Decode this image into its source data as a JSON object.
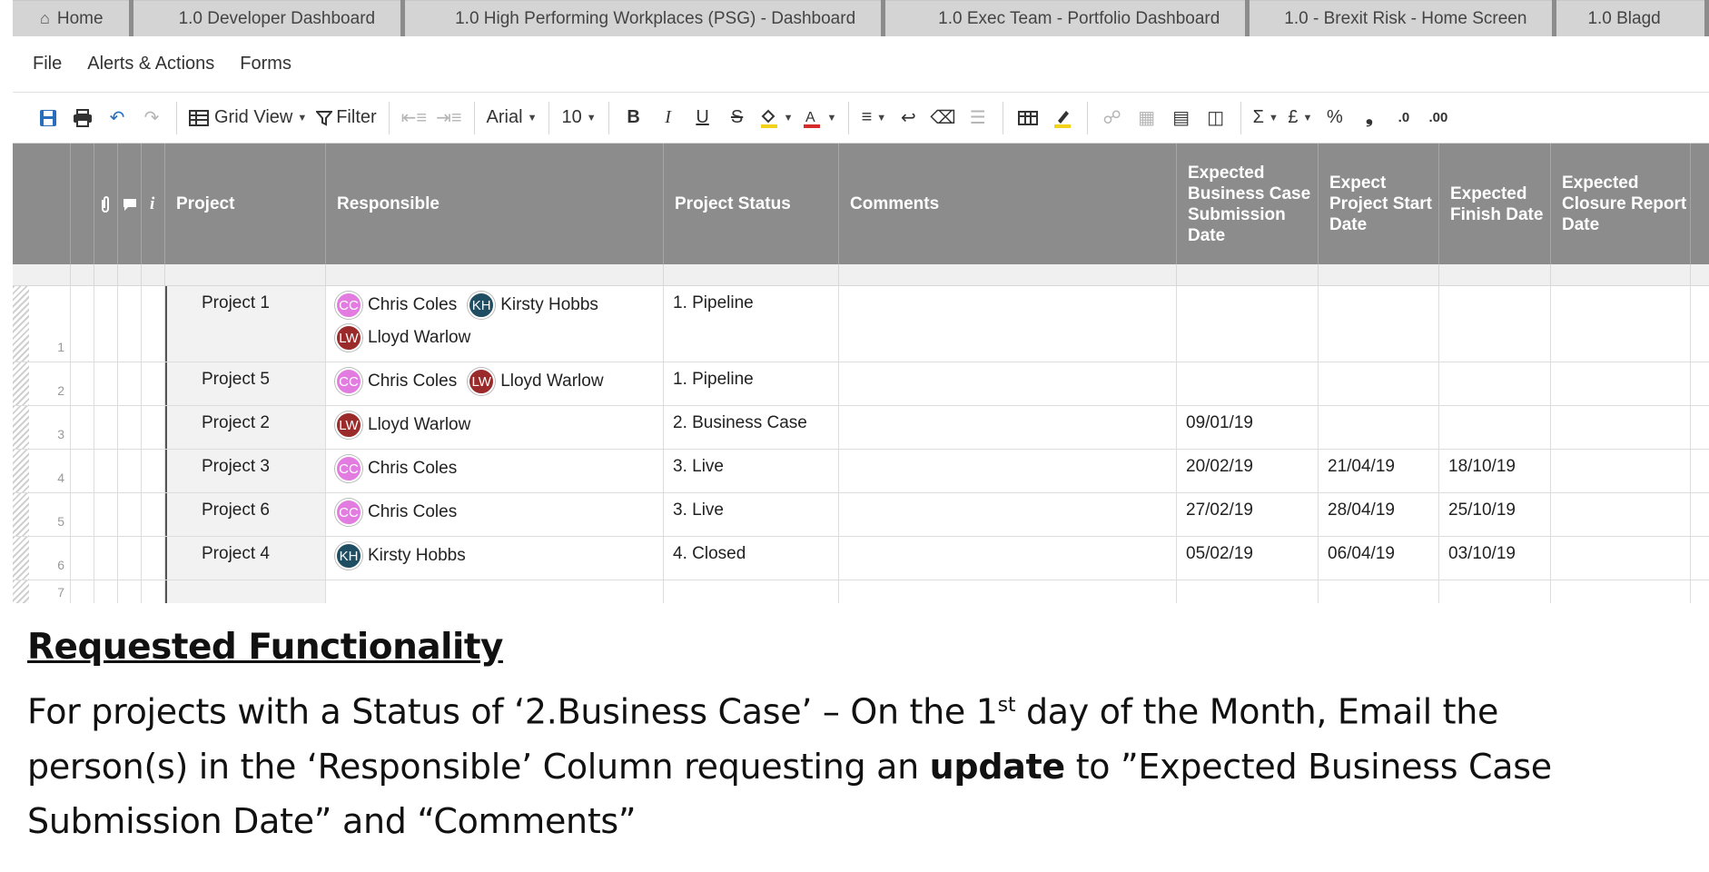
{
  "tabs": [
    {
      "label": "Home",
      "icon": "home-icon"
    },
    {
      "label": "1.0 Developer Dashboard"
    },
    {
      "label": "1.0 High Performing Workplaces (PSG) - Dashboard"
    },
    {
      "label": "1.0 Exec Team - Portfolio Dashboard"
    },
    {
      "label": "1.0 - Brexit Risk - Home Screen"
    },
    {
      "label": "1.0 Blagd"
    }
  ],
  "menu": {
    "file": "File",
    "alerts": "Alerts & Actions",
    "forms": "Forms"
  },
  "toolbar": {
    "grid_view": "Grid View",
    "filter": "Filter",
    "font": "Arial",
    "font_size": "10",
    "bold": "B",
    "italic": "I",
    "underline": "U",
    "strike": "S",
    "sum": "Σ",
    "currency": "£",
    "percent": "%",
    "comma": "❟",
    "dec_less": ".0",
    "dec_more": ".00"
  },
  "columns": {
    "project": "Project",
    "responsible": "Responsible",
    "status": "Project Status",
    "comments": "Comments",
    "business_case": "Expected Business Case Submission Date",
    "start": "Expect Project Start Date",
    "finish": "Expected Finish Date",
    "closure": "Expected Closure Report Date",
    "info": "i"
  },
  "rows": [
    {
      "num": "1",
      "project": "Project 1",
      "people": [
        {
          "initials": "CC",
          "name": "Chris Coles"
        },
        {
          "initials": "KH",
          "name": "Kirsty Hobbs"
        },
        {
          "initials": "LW",
          "name": "Lloyd Warlow"
        }
      ],
      "status": "1. Pipeline",
      "comments": "",
      "business_case": "",
      "start": "",
      "finish": "",
      "closure": ""
    },
    {
      "num": "2",
      "project": "Project 5",
      "people": [
        {
          "initials": "CC",
          "name": "Chris Coles"
        },
        {
          "initials": "LW",
          "name": "Lloyd Warlow"
        }
      ],
      "status": "1. Pipeline",
      "comments": "",
      "business_case": "",
      "start": "",
      "finish": "",
      "closure": ""
    },
    {
      "num": "3",
      "project": "Project 2",
      "people": [
        {
          "initials": "LW",
          "name": "Lloyd Warlow"
        }
      ],
      "status": "2. Business Case",
      "comments": "",
      "business_case": "09/01/19",
      "start": "",
      "finish": "",
      "closure": ""
    },
    {
      "num": "4",
      "project": "Project 3",
      "people": [
        {
          "initials": "CC",
          "name": "Chris Coles"
        }
      ],
      "status": "3. Live",
      "comments": "",
      "business_case": "20/02/19",
      "start": "21/04/19",
      "finish": "18/10/19",
      "closure": ""
    },
    {
      "num": "5",
      "project": "Project 6",
      "people": [
        {
          "initials": "CC",
          "name": "Chris Coles"
        }
      ],
      "status": "3. Live",
      "comments": "",
      "business_case": "27/02/19",
      "start": "28/04/19",
      "finish": "25/10/19",
      "closure": ""
    },
    {
      "num": "6",
      "project": "Project 4",
      "people": [
        {
          "initials": "KH",
          "name": "Kirsty Hobbs"
        }
      ],
      "status": "4. Closed",
      "comments": "",
      "business_case": "05/02/19",
      "start": "06/04/19",
      "finish": "03/10/19",
      "closure": ""
    },
    {
      "num": "7",
      "project": "",
      "people": [],
      "status": "",
      "comments": "",
      "business_case": "",
      "start": "",
      "finish": "",
      "closure": ""
    }
  ],
  "avatar_colors": {
    "CC": "#e27ce0",
    "KH": "#1f4e63",
    "LW": "#9b2b2b"
  },
  "requested": {
    "title": "Requested Functionality",
    "line_1a": "For projects with a Status of ‘2.Business Case’ – On the 1",
    "line_1_sup": "st",
    "line_1b": " day of the Month, Email the",
    "line_2a": "person(s) in the ‘Responsible’ Column requesting an ",
    "line_2_bold": "update",
    "line_2b": " to ”Expected Business Case",
    "line_3": "Submission Date” and “Comments”"
  }
}
